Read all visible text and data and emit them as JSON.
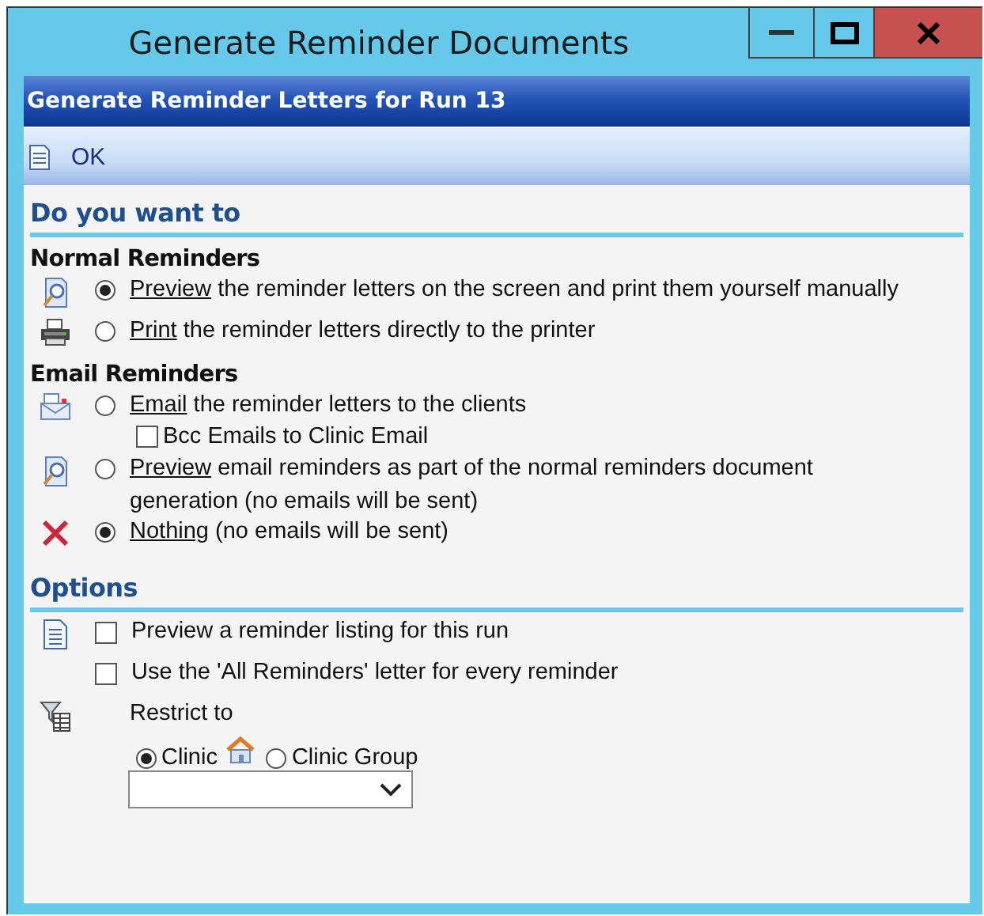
{
  "window": {
    "title": "Generate Reminder Documents"
  },
  "header": "Generate Reminder Letters for Run 13",
  "toolbar": [
    {
      "label": "OK"
    }
  ],
  "question": {
    "title": "Do you want to",
    "groups": [
      {
        "title": "Normal Reminders",
        "options": [
          {
            "kind": "preview",
            "selected": true,
            "link": "Preview",
            "text": " the reminder letters on the screen and print them yourself manually"
          },
          {
            "kind": "print",
            "selected": false,
            "link": "Print",
            "text": " the reminder letters directly to the printer"
          }
        ]
      },
      {
        "title": "Email Reminders",
        "options": [
          {
            "kind": "email",
            "selected": false,
            "link": "Email",
            "text": " the reminder letters to the clients",
            "sub": {
              "label": "Bcc Emails to Clinic Email",
              "checked": false
            }
          },
          {
            "kind": "preview",
            "selected": false,
            "link": "Preview",
            "text": " email reminders as part of the normal reminders document generation (no emails will be sent)"
          },
          {
            "kind": "none",
            "selected": true,
            "link": "Nothing",
            "text": " (no emails will be sent)"
          }
        ]
      }
    ]
  },
  "options": {
    "title": "Options",
    "checkboxes": [
      {
        "kind": "listing",
        "label": "Preview a reminder listing for this run",
        "checked": false
      },
      {
        "kind": "plain",
        "label": "Use the 'All Reminders' letter for every reminder",
        "checked": false
      }
    ],
    "restrict": {
      "label": "Restrict to",
      "choices": [
        {
          "label": "Clinic",
          "selected": true,
          "kind": "clinic"
        },
        {
          "label": "Clinic Group",
          "selected": false,
          "kind": "group"
        }
      ]
    }
  }
}
